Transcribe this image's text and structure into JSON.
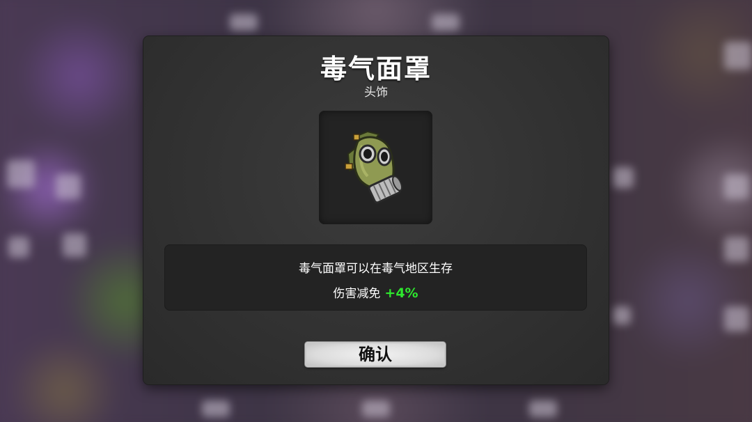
{
  "dialog": {
    "title": "毒气面罩",
    "subtitle": "头饰",
    "item": {
      "icon": "gas-mask-icon"
    },
    "description": "毒气面罩可以在毒气地区生存",
    "stat": {
      "label": "伤害减免",
      "value": "+4%",
      "value_color": "#2ee82e"
    },
    "confirm_label": "确认"
  }
}
